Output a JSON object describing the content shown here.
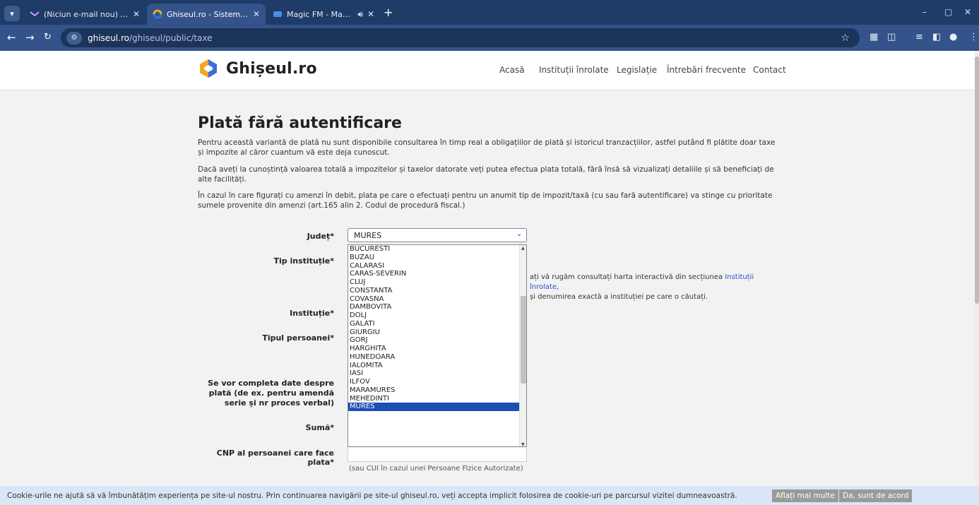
{
  "browser": {
    "tabs": [
      {
        "title": "(Niciun e-mail nou) - ccdmures",
        "active": false
      },
      {
        "title": "Ghiseul.ro - Sistemul National E",
        "active": true
      },
      {
        "title": "Magic FM - Magic FM Live",
        "active": false
      }
    ],
    "new_tab": "+",
    "url_domain": "ghiseul.ro",
    "url_path": "/ghiseul/public/taxe",
    "window_controls": [
      "–",
      "▢",
      "✕"
    ]
  },
  "header": {
    "logo_text": "Ghișeul.ro",
    "nav": [
      "Acasă",
      "Instituții înrolate",
      "Legislație",
      "Întrebări frecvente",
      "Contact"
    ]
  },
  "main": {
    "title": "Plată fără autentificare",
    "paragraphs": [
      "Pentru această variantă de plată nu sunt disponibile consultarea în timp real a obligațiilor de plată și istoricul tranzacțiilor, astfel putând fi plătite doar taxe și impozite al căror cuantum vă este deja cunoscut.",
      "Dacă aveți la cunoștință valoarea totală a impozitelor și taxelor datorate veți putea efectua plata totală, fără însă să vizualizați detaliile și să beneficiați de alte facilități.",
      "În cazul în care figurați cu amenzi în debit, plata pe care o efectuați pentru un anumit tip de impozit/taxă (cu sau fară autentificare) va stinge cu prioritate sumele provenite din amenzi (art.165 alin 2. Codul de procedură fiscal.)"
    ],
    "labels": {
      "judet": "Județ*",
      "tip_institutie": "Tip instituție*",
      "institutie": "Instituție*",
      "tipul_persoanei": "Tipul persoanei*",
      "detalii": "Se vor completa date despre plată (de ex. pentru amendă serie și nr proces verbal)",
      "suma": "Sumă*",
      "cnp": "CNP al persoanei care face plata*"
    },
    "judet_selected": "MURES",
    "judet_options": [
      "BUCURESTI",
      "BUZAU",
      "CALARASI",
      "CARAS-SEVERIN",
      "CLUJ",
      "CONSTANTA",
      "COVASNA",
      "DAMBOVITA",
      "DOLJ",
      "GALATI",
      "GIURGIU",
      "GORJ",
      "HARGHITA",
      "HUNEDOARA",
      "IALOMITA",
      "IASI",
      "ILFOV",
      "MARAMURES",
      "MEHEDINTI",
      "MURES"
    ],
    "hint_line1_a": "ați vă rugăm consultați harta interactivă din secțiunea ",
    "hint_link": "Instituții înrolate",
    "hint_line1_b": ",",
    "hint_line2": "și denumirea exactă a instituției pe care o căutați.",
    "cnp_hint": "(sau CUI în cazul unei Persoane Fizice Autorizate)"
  },
  "cookie": {
    "message": "Cookie-urile ne ajută să vă îmbunătățim experiența pe site-ul nostru. Prin continuarea navigării pe site-ul ghiseul.ro, veți accepta implicit folosirea de cookie-uri pe parcursul vizitei dumneavoastră.",
    "more": "Aflați mai multe",
    "accept": "Da, sunt de acord"
  },
  "colors": {
    "selected": "#1c4fb0",
    "link": "#2f4ec9",
    "chrome": "#33538a"
  }
}
